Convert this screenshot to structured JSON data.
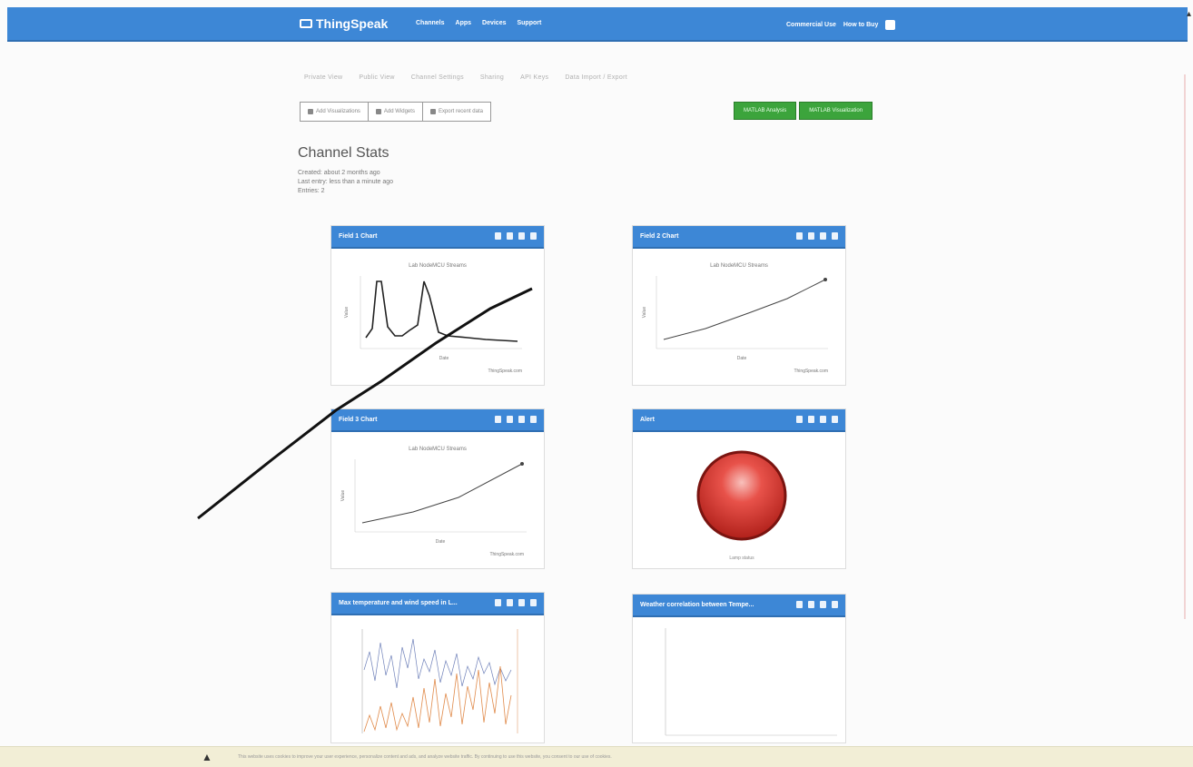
{
  "navbar": {
    "brand": "ThingSpeak",
    "links": [
      "Channels",
      "Apps",
      "Devices",
      "Support"
    ],
    "right": [
      "Commercial Use",
      "How to Buy"
    ]
  },
  "tabs": [
    "Private View",
    "Public View",
    "Channel Settings",
    "Sharing",
    "API Keys",
    "Data Import / Export"
  ],
  "export_buttons": [
    "Add Visualizations",
    "Add Widgets",
    "Export recent data"
  ],
  "green_buttons": [
    "MATLAB Analysis",
    "MATLAB Visualization"
  ],
  "channel_stats": {
    "title": "Channel Stats",
    "created": "Created: about 2 months ago",
    "last_entry": "Last entry: less than a minute ago",
    "entries": "Entries: 2"
  },
  "widgets": [
    {
      "title": "Field 1 Chart",
      "chart_title": "Lab NodeMCU Streams",
      "xlabel": "Date",
      "ylabel": "Value",
      "footer": "ThingSpeak.com"
    },
    {
      "title": "Field 2 Chart",
      "chart_title": "Lab NodeMCU Streams",
      "xlabel": "Date",
      "ylabel": "Value",
      "footer": "ThingSpeak.com"
    },
    {
      "title": "Field 3 Chart",
      "chart_title": "Lab NodeMCU Streams",
      "xlabel": "Date",
      "ylabel": "Value",
      "footer": "ThingSpeak.com"
    },
    {
      "title": "Alert",
      "caption": "Lamp status"
    },
    {
      "title": "Max temperature and wind speed in L...",
      "footer": ""
    },
    {
      "title": "Weather correlation between Tempe..."
    }
  ],
  "bottom_bar": {
    "message": "This website uses cookies to improve your user experience, personalize content and ads, and analyze website traffic. By continuing to use this website, you consent to our use of cookies."
  },
  "colors": {
    "navbar": "#3d87d6",
    "widget_header": "#3d87d6",
    "green_button": "#3ca43c",
    "lamp": "#d0312d"
  }
}
